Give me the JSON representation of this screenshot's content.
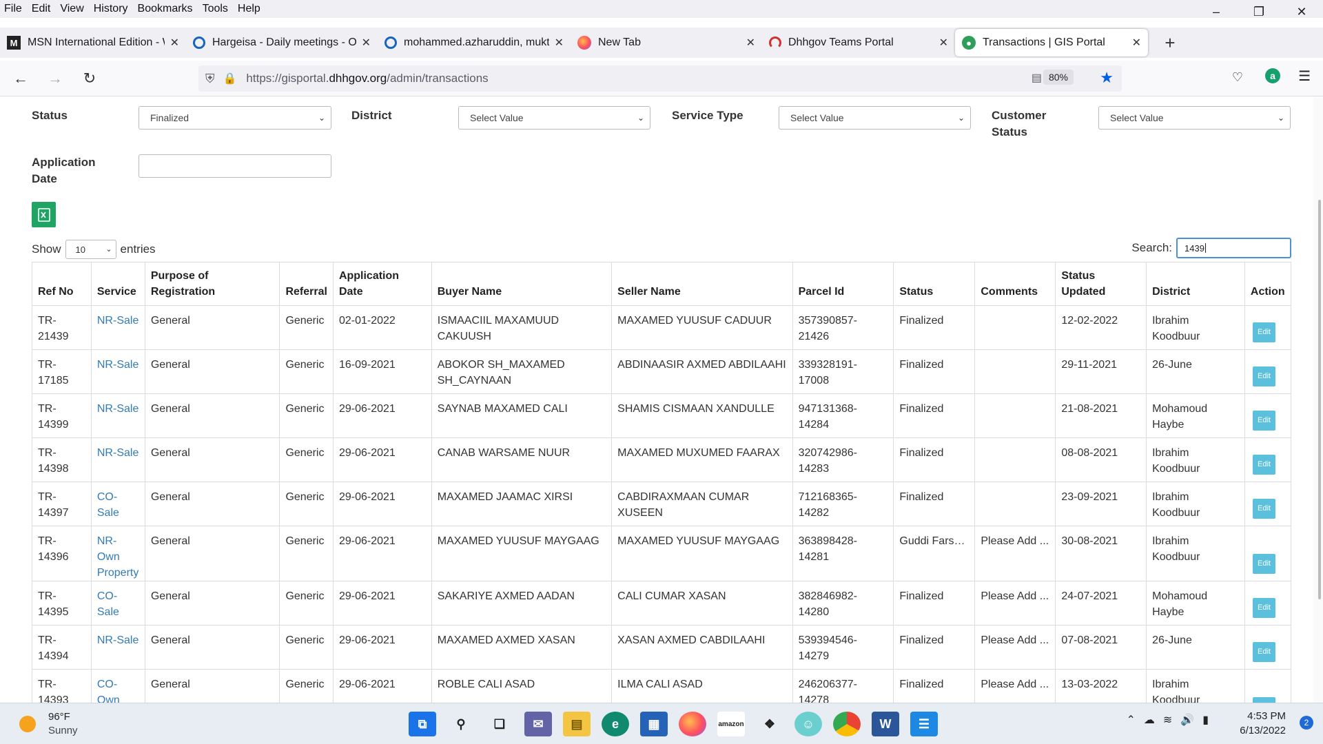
{
  "menu": [
    "File",
    "Edit",
    "View",
    "History",
    "Bookmarks",
    "Tools",
    "Help"
  ],
  "tabs": [
    {
      "title": "MSN International Edition - Wo",
      "icon": "msn-icon"
    },
    {
      "title": "Hargeisa - Daily meetings - Op",
      "icon": "openproject-icon"
    },
    {
      "title": "mohammed.azharuddin, mukth",
      "icon": "openproject-icon"
    },
    {
      "title": "New Tab",
      "icon": "firefox-icon"
    },
    {
      "title": "Dhhgov Teams Portal",
      "icon": "teams-portal-icon"
    },
    {
      "title": "Transactions | GIS Portal",
      "icon": "gis-portal-icon"
    }
  ],
  "url": {
    "prefix": "https://gisportal.",
    "domain": "dhhgov.org",
    "path": "/admin/transactions"
  },
  "zoom": "80%",
  "filters": {
    "status_label": "Status",
    "status_value": "Finalized",
    "district_label": "District",
    "district_value": "Select Value",
    "service_type_label": "Service Type",
    "service_type_value": "Select Value",
    "customer_status_label1": "Customer",
    "customer_status_label2": "Status",
    "customer_status_value": "Select Value",
    "application_date_label1": "Application",
    "application_date_label2": "Date",
    "application_date_value": ""
  },
  "show": {
    "prefix": "Show",
    "value": "10",
    "suffix": "entries"
  },
  "search": {
    "label": "Search:",
    "value": "1439"
  },
  "table": {
    "headers": [
      {
        "l1": "",
        "l2": "Ref No"
      },
      {
        "l1": "",
        "l2": "Service"
      },
      {
        "l1": "Purpose of",
        "l2": "Registration"
      },
      {
        "l1": "",
        "l2": "Referral"
      },
      {
        "l1": "Application",
        "l2": "Date"
      },
      {
        "l1": "",
        "l2": "Buyer Name"
      },
      {
        "l1": "",
        "l2": "Seller Name"
      },
      {
        "l1": "",
        "l2": "Parcel Id"
      },
      {
        "l1": "",
        "l2": "Status"
      },
      {
        "l1": "",
        "l2": "Comments"
      },
      {
        "l1": "Status",
        "l2": "Updated"
      },
      {
        "l1": "",
        "l2": "District"
      },
      {
        "l1": "",
        "l2": "Action"
      }
    ],
    "edit_label": "Edit",
    "rows": [
      [
        "TR-21439",
        "NR-Sale",
        "General",
        "Generic",
        "02-01-2022",
        "ISMAACIIL MAXAMUUD CAKUUSH",
        "MAXAMED YUUSUF CADUUR",
        "357390857-21426",
        "Finalized",
        "",
        "12-02-2022",
        "Ibrahim Koodbuur"
      ],
      [
        "TR-17185",
        "NR-Sale",
        "General",
        "Generic",
        "16-09-2021",
        "ABOKOR SH_MAXAMED SH_CAYNAAN",
        "ABDINAASIR AXMED ABDILAAHI",
        "339328191-17008",
        "Finalized",
        "",
        "29-11-2021",
        "26-June"
      ],
      [
        "TR-14399",
        "NR-Sale",
        "General",
        "Generic",
        "29-06-2021",
        "SAYNAB MAXAMED CALI",
        "SHAMIS CISMAAN XANDULLE",
        "947131368-14284",
        "Finalized",
        "",
        "21-08-2021",
        "Mohamoud Haybe"
      ],
      [
        "TR-14398",
        "NR-Sale",
        "General",
        "Generic",
        "29-06-2021",
        "CANAB WARSAME NUUR",
        "MAXAMED MUXUMED FAARAX",
        "320742986-14283",
        "Finalized",
        "",
        "08-08-2021",
        "Ibrahim Koodbuur"
      ],
      [
        "TR-14397",
        "CO-Sale",
        "General",
        "Generic",
        "29-06-2021",
        "MAXAMED JAAMAC XIRSI",
        "CABDIRAXMAAN CUMAR XUSEEN",
        "712168365-14282",
        "Finalized",
        "",
        "23-09-2021",
        "Ibrahim Koodbuur"
      ],
      [
        "TR-14396",
        "NR-Own Property",
        "General",
        "Generic",
        "29-06-2021",
        "MAXAMED YUUSUF MAYGAAG",
        "MAXAMED YUUSUF MAYGAAG",
        "363898428-14281",
        "Guddi Farso...",
        "Please Add ...",
        "30-08-2021",
        "Ibrahim Koodbuur"
      ],
      [
        "TR-14395",
        "CO-Sale",
        "General",
        "Generic",
        "29-06-2021",
        "SAKARIYE AXMED AADAN",
        "CALI CUMAR XASAN",
        "382846982-14280",
        "Finalized",
        "Please Add ...",
        "24-07-2021",
        "Mohamoud Haybe"
      ],
      [
        "TR-14394",
        "NR-Sale",
        "General",
        "Generic",
        "29-06-2021",
        "MAXAMED AXMED XASAN",
        "XASAN AXMED CABDILAAHI",
        "539394546-14279",
        "Finalized",
        "Please Add ...",
        "07-08-2021",
        "26-June"
      ],
      [
        "TR-14393",
        "CO-Own Property",
        "General",
        "Generic",
        "29-06-2021",
        "ROBLE CALI ASAD",
        "ILMA CALI ASAD",
        "246206377-14278",
        "Finalized",
        "Please Add ...",
        "13-03-2022",
        "Ibrahim Koodbuur"
      ]
    ]
  },
  "taskbar": {
    "temp": "96°F",
    "condition": "Sunny",
    "time": "4:53 PM",
    "date": "6/13/2022",
    "notifications": "2",
    "apps": [
      "windows-start-icon",
      "search-icon",
      "task-view-icon",
      "teams-chat-icon",
      "file-explorer-icon",
      "edge-icon",
      "microsoft-store-icon",
      "firefox-icon",
      "amazon-icon",
      "dropbox-icon",
      "messaging-icon",
      "chrome-icon",
      "word-icon",
      "notepad-icon"
    ]
  }
}
